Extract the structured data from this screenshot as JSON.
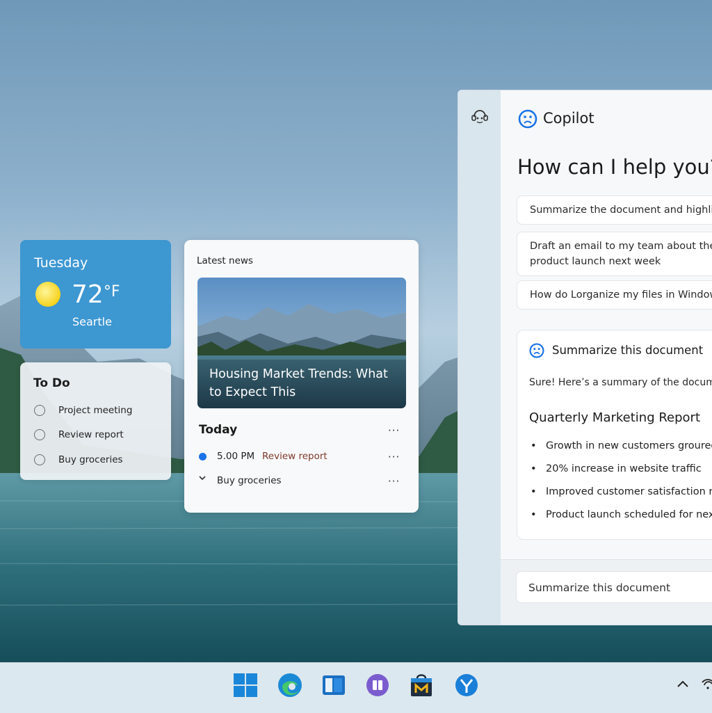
{
  "weather": {
    "day": "Tuesday",
    "temperature": "72",
    "unit": "°F",
    "city": "Seartle"
  },
  "todo": {
    "title": "To Do",
    "items": [
      "Project meeting",
      "Review report",
      "Buy groceries"
    ]
  },
  "news": {
    "label": "Latest news",
    "headline": "Housing Market Trends: What to Expect This",
    "today_label": "Today",
    "more_glyph": "···",
    "event_time": "5.00 PM",
    "event_title": "Review report",
    "collapsed_item": "Buy groceries"
  },
  "copilot": {
    "title": "Copilot",
    "heading": "How can I help you?",
    "suggestions": [
      "Summarize the document and highlig",
      "Draft an email to my team about the n product launch next week",
      "How do Lorganize my files in Window"
    ],
    "suggestion_2_lines": [
      "Draft an email to my team about the n",
      "product launch next week"
    ],
    "response": {
      "title": "Summarize this document",
      "intro": "Sure! Here’s a summary of the docum",
      "report_title": "Quarterly Marketing Report",
      "bullets": [
        "Growth in new customers groured",
        "20% increase in website traffic",
        "Improved customer satisfaction ra",
        "Product launch scheduled for nextr"
      ]
    },
    "input_value": "Summarize this document"
  },
  "taskbar": {
    "icons": [
      "windows-start-icon",
      "edge-browser-icon",
      "file-explorer-icon",
      "copilot-app-icon",
      "microsoft-store-icon",
      "yammer-icon"
    ]
  },
  "colors": {
    "accent": "#1a73e8",
    "weather_bg": "#3d97d1"
  }
}
